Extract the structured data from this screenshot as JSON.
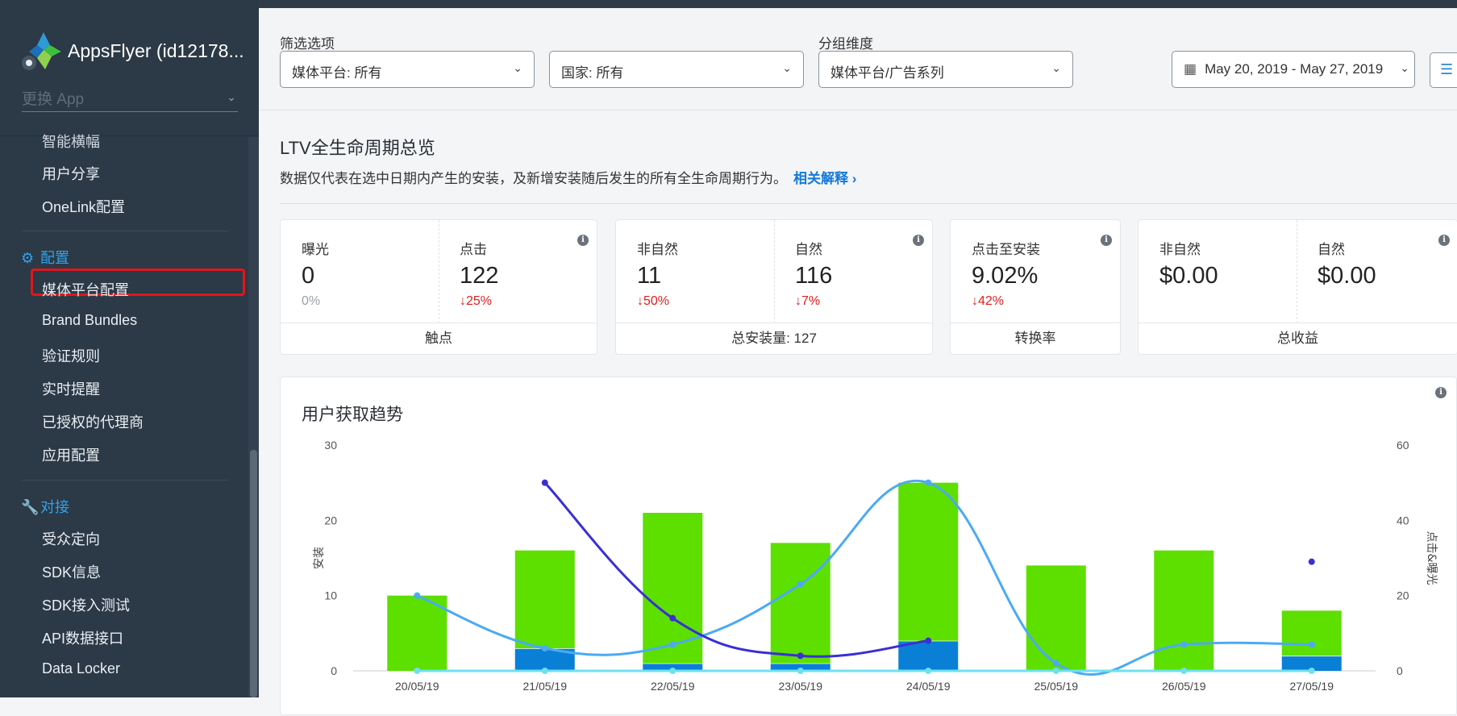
{
  "sidebar": {
    "app_name": "AppsFlyer (id12178...",
    "switch_app_placeholder": "更换 App",
    "items_top": [
      "智能横幅",
      "用户分享",
      "OneLink配置"
    ],
    "section_config": "配置",
    "config_items": [
      "媒体平台配置",
      "Brand Bundles",
      "验证规则",
      "实时提醒",
      "已授权的代理商",
      "应用配置"
    ],
    "section_integration": "对接",
    "integration_items": [
      "受众定向",
      "SDK信息",
      "SDK接入测试",
      "API数据接口",
      "Data Locker"
    ]
  },
  "filters": {
    "label_filter": "筛选选项",
    "media_source": "媒体平台: 所有",
    "country": "国家: 所有",
    "label_group": "分组维度",
    "group_by": "媒体平台/广告系列",
    "date_range": "May 20, 2019 - May 27, 2019"
  },
  "overview": {
    "title": "LTV全生命周期总览",
    "subtitle": "数据仅代表在选中日期内产生的安装，及新增安装随后发生的所有全生命周期行为。",
    "link": "相关解释 ›"
  },
  "cards": {
    "touchpoints": {
      "impressions_label": "曝光",
      "impressions_value": "0",
      "impressions_change": "0%",
      "clicks_label": "点击",
      "clicks_value": "122",
      "clicks_change": "↓25%",
      "footer": "触点"
    },
    "installs": {
      "nonorganic_label": "非自然",
      "nonorganic_value": "11",
      "nonorganic_change": "↓50%",
      "organic_label": "自然",
      "organic_value": "116",
      "organic_change": "↓7%",
      "footer": "总安装量: 127"
    },
    "conversion": {
      "label": "点击至安装",
      "value": "9.02%",
      "change": "↓42%",
      "footer": "转换率"
    },
    "revenue": {
      "nonorganic_label": "非自然",
      "nonorganic_value": "$0.00",
      "organic_label": "自然",
      "organic_value": "$0.00",
      "footer": "总收益"
    }
  },
  "chart_data": {
    "type": "bar",
    "title": "用户获取趋势",
    "categories": [
      "20/05/19",
      "21/05/19",
      "22/05/19",
      "23/05/19",
      "24/05/19",
      "25/05/19",
      "26/05/19",
      "27/05/19"
    ],
    "ylabel": "安装",
    "y2label": "点击&曝光",
    "ylim": [
      0,
      30
    ],
    "y2lim": [
      0,
      60
    ],
    "yticks": [
      0,
      10,
      20,
      30
    ],
    "y2ticks": [
      0,
      20,
      40,
      60
    ],
    "series": [
      {
        "type": "bar",
        "axis": "left",
        "color": "#0a7fd6",
        "values": [
          0,
          3,
          1,
          1,
          4,
          0,
          0,
          2
        ]
      },
      {
        "type": "bar",
        "axis": "left",
        "color": "#5ddf00",
        "values": [
          10,
          13,
          20,
          16,
          21,
          14,
          16,
          6
        ]
      },
      {
        "type": "line",
        "axis": "right",
        "color": "#4baaf3",
        "values": [
          20,
          6,
          7,
          23,
          50,
          2,
          7,
          7
        ]
      },
      {
        "type": "line",
        "axis": "right",
        "color": "#3a2fd4",
        "values": [
          null,
          50,
          14,
          4,
          8,
          null,
          null,
          29
        ]
      },
      {
        "type": "line",
        "axis": "right",
        "color": "#6fe0f0",
        "values": [
          0,
          0,
          0,
          0,
          0,
          0,
          0,
          0
        ]
      }
    ]
  }
}
